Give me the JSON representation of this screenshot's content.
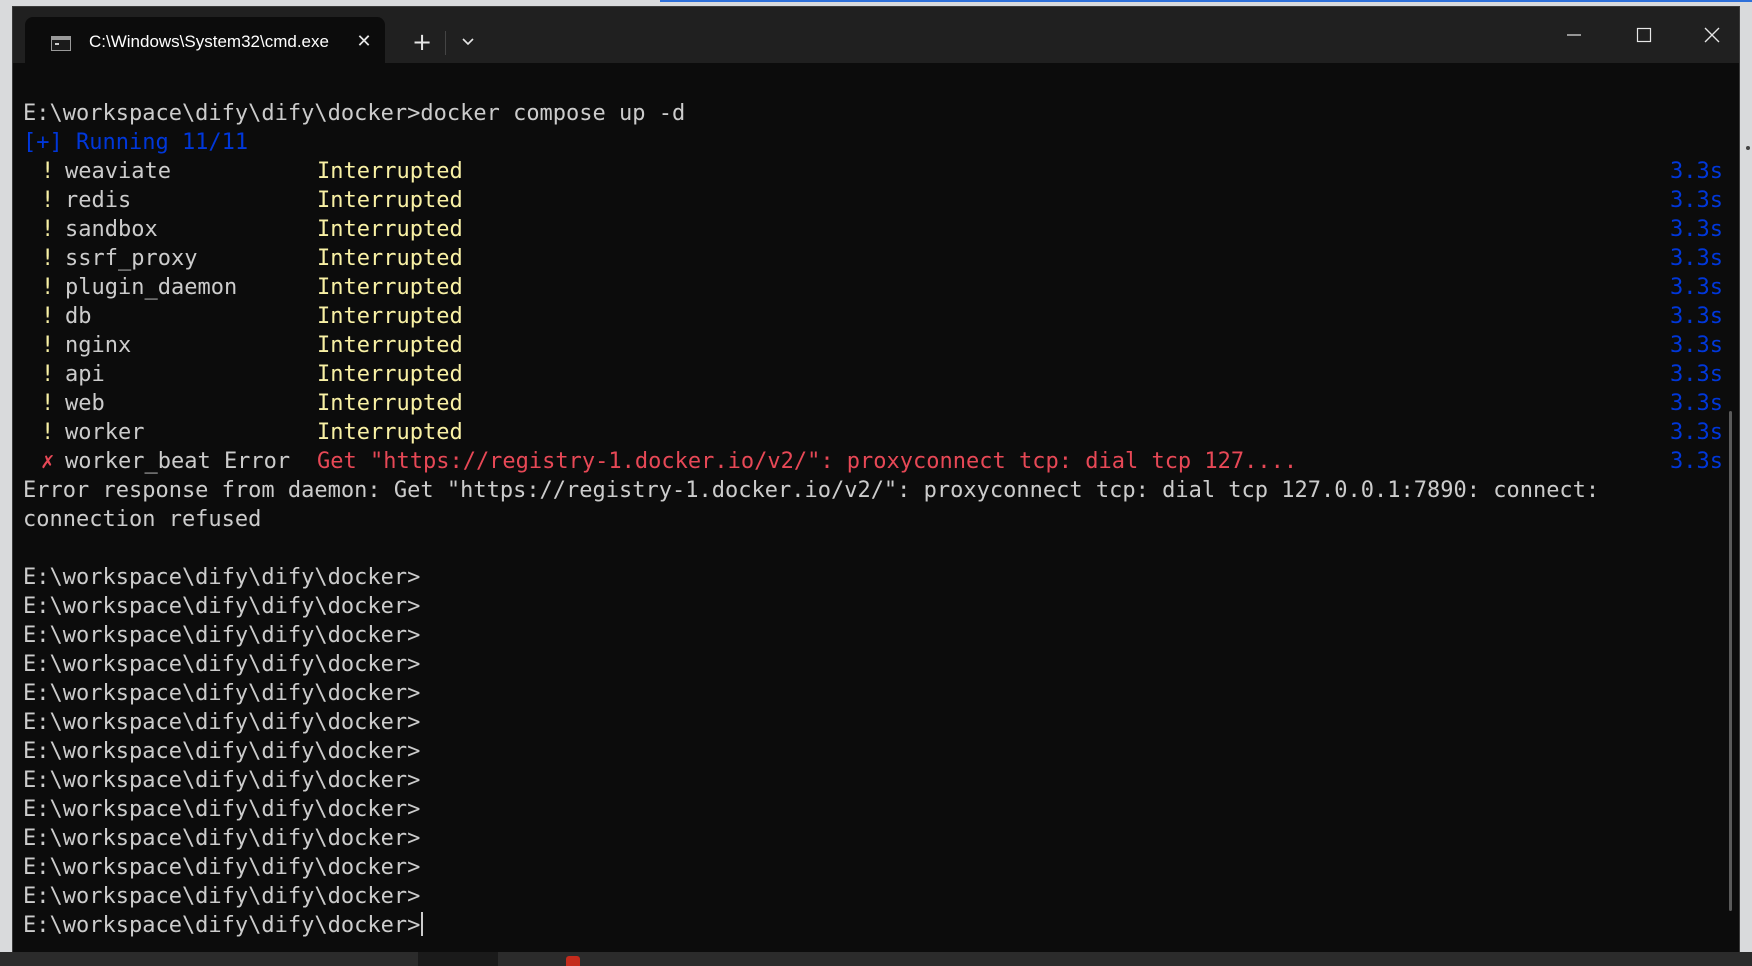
{
  "window": {
    "tab_title": "C:\\Windows\\System32\\cmd.exe",
    "new_tab_symbol": "+",
    "colors": {
      "terminal_bg": "#0c0c0c",
      "titlebar_bg": "#202020",
      "warning_yellow": "#f9f1a5",
      "error_red": "#e74856",
      "info_blue": "#0037da",
      "text": "#cccccc"
    }
  },
  "terminal": {
    "command_line": "E:\\workspace\\dify\\dify\\docker>docker compose up -d",
    "running_line": "[+] Running 11/11",
    "services": [
      {
        "mark": "!",
        "name": "weaviate",
        "status": "Interrupted",
        "time": "3.3s",
        "state": "warn"
      },
      {
        "mark": "!",
        "name": "redis",
        "status": "Interrupted",
        "time": "3.3s",
        "state": "warn"
      },
      {
        "mark": "!",
        "name": "sandbox",
        "status": "Interrupted",
        "time": "3.3s",
        "state": "warn"
      },
      {
        "mark": "!",
        "name": "ssrf_proxy",
        "status": "Interrupted",
        "time": "3.3s",
        "state": "warn"
      },
      {
        "mark": "!",
        "name": "plugin_daemon",
        "status": "Interrupted",
        "time": "3.3s",
        "state": "warn"
      },
      {
        "mark": "!",
        "name": "db",
        "status": "Interrupted",
        "time": "3.3s",
        "state": "warn"
      },
      {
        "mark": "!",
        "name": "nginx",
        "status": "Interrupted",
        "time": "3.3s",
        "state": "warn"
      },
      {
        "mark": "!",
        "name": "api",
        "status": "Interrupted",
        "time": "3.3s",
        "state": "warn"
      },
      {
        "mark": "!",
        "name": "web",
        "status": "Interrupted",
        "time": "3.3s",
        "state": "warn"
      },
      {
        "mark": "!",
        "name": "worker",
        "status": "Interrupted",
        "time": "3.3s",
        "state": "warn"
      },
      {
        "mark": "✗",
        "name": "worker_beat Error",
        "status": "Get \"https://registry-1.docker.io/v2/\": proxyconnect tcp: dial tcp 127....",
        "time": "3.3s",
        "state": "error"
      }
    ],
    "error_response_1": "Error response from daemon: Get \"https://registry-1.docker.io/v2/\": proxyconnect tcp: dial tcp 127.0.0.1:7890: connect:",
    "error_response_2": "connection refused",
    "prompt": "E:\\workspace\\dify\\dify\\docker>"
  }
}
